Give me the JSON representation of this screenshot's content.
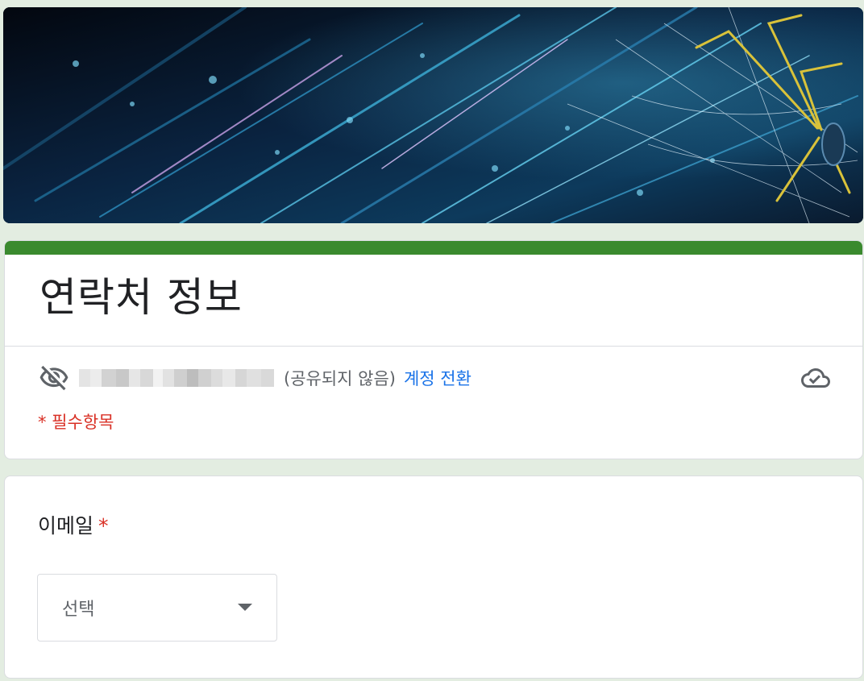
{
  "form": {
    "title": "연락처 정보",
    "not_shared": "(공유되지 않음)",
    "switch_account": "계정 전환",
    "required_note": "* 필수항목"
  },
  "question": {
    "label": "이메일",
    "required_mark": "*",
    "select_placeholder": "선택"
  },
  "colors": {
    "accent": "#3a8a2e",
    "required": "#d93025",
    "link": "#1a73e8",
    "background": "#e3ede1"
  },
  "icons": {
    "visibility": "visibility-off-icon",
    "cloud": "cloud-done-icon",
    "dropdown": "dropdown-caret-icon"
  }
}
